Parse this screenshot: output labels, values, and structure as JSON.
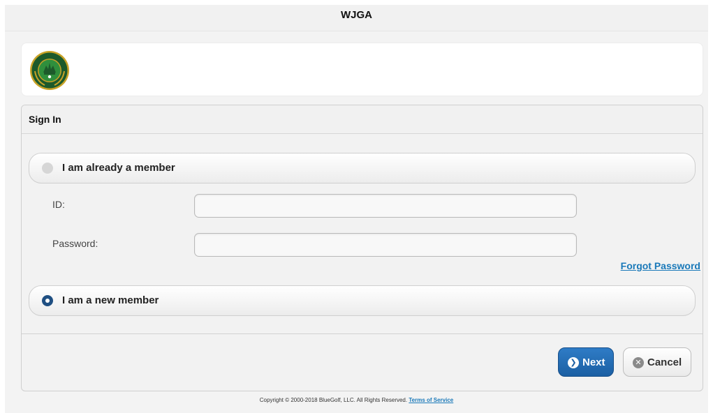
{
  "app": {
    "title": "WJGA"
  },
  "logo": {
    "text_top": "WASHINGTON",
    "text_middle": "JUNIOR",
    "text_bottom": "GOLF ASSOCIATION",
    "colors": {
      "ring": "#1d5a2b",
      "gold": "#c9a227",
      "field": "#2f8f3c"
    }
  },
  "signin": {
    "title": "Sign In",
    "existing_member": {
      "label": "I am already a member",
      "selected": false
    },
    "id_label": "ID:",
    "id_value": "",
    "password_label": "Password:",
    "password_value": "",
    "forgot_password": "Forgot Password",
    "new_member": {
      "label": "I am a new member",
      "selected": true
    },
    "buttons": {
      "next": {
        "label": "Next",
        "icon": "chevron-right-icon"
      },
      "cancel": {
        "label": "Cancel",
        "icon": "close-circle-icon"
      }
    }
  },
  "footer": {
    "copyright": "Copyright © 2000-2018 BlueGolf, LLC. All Rights Reserved.",
    "terms_link": "Terms of Service"
  },
  "colors": {
    "primary_button": "#1b5fa3",
    "link": "#1a79b9",
    "radio_selected": "#1f4f82"
  }
}
